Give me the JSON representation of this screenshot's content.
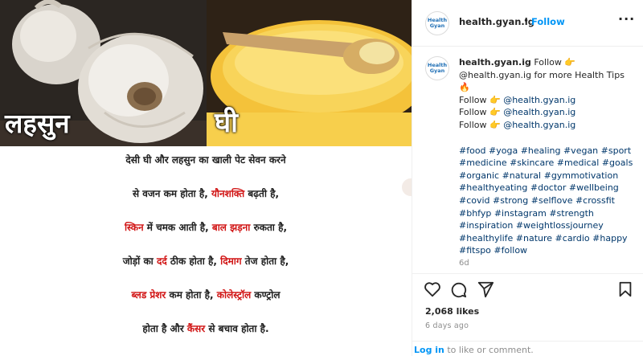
{
  "post_image": {
    "label_garlic": "लहसुन",
    "label_ghee": "घी",
    "text_lines": [
      [
        {
          "t": "देसी घी और लहसुन का खाली पेट सेवन करने",
          "red": false
        }
      ],
      [
        {
          "t": "से वजन कम होता है, ",
          "red": false
        },
        {
          "t": "यौनशक्ति",
          "red": true
        },
        {
          "t": " बढ़ती है,",
          "red": false
        }
      ],
      [
        {
          "t": "स्किन",
          "red": true
        },
        {
          "t": " में चमक आती है, ",
          "red": false
        },
        {
          "t": "बाल झड़ना",
          "red": true
        },
        {
          "t": " रुकता है,",
          "red": false
        }
      ],
      [
        {
          "t": "जोड़ों का ",
          "red": false
        },
        {
          "t": "दर्द",
          "red": true
        },
        {
          "t": " ठीक होता है, ",
          "red": false
        },
        {
          "t": "दिमाग",
          "red": true
        },
        {
          "t": " तेज होता है,",
          "red": false
        }
      ],
      [
        {
          "t": "ब्लड प्रेशर",
          "red": true
        },
        {
          "t": " कम होता है, ",
          "red": false
        },
        {
          "t": "कोलेस्ट्रॉल",
          "red": true
        },
        {
          "t": " कण्ट्रोल",
          "red": false
        }
      ],
      [
        {
          "t": "होता है और ",
          "red": false
        },
        {
          "t": "कैंसर",
          "red": true
        },
        {
          "t": " से बचाव होता है.",
          "red": false
        }
      ]
    ]
  },
  "header": {
    "avatar_text_1": "Health",
    "avatar_text_2": "Gyan",
    "username": "health.gyan.ig",
    "dot": "•",
    "follow_label": "Follow",
    "more_label": "···"
  },
  "caption": {
    "username": "health.gyan.ig",
    "line1_rest": " Follow 👉",
    "line2": "@health.gyan.ig for more Health Tips",
    "line3": "🔥",
    "follow_lines": [
      {
        "prefix": "Follow 👉 ",
        "mention": "@health.gyan.ig"
      },
      {
        "prefix": "Follow 👉 ",
        "mention": "@health.gyan.ig"
      },
      {
        "prefix": "Follow 👉 ",
        "mention": "@health.gyan.ig"
      }
    ],
    "hashtags": "#food #yoga #healing #vegan #sport #medicine #skincare #medical #goals #organic #natural #gymmotivation #healthyeating #doctor #wellbeing #covid #strong #selflove #crossfit #bhfyp #instagram #strength #inspiration #weightlossjourney #healthylife #nature #cardio #happy #fitspo #follow",
    "time": "6d"
  },
  "actions": {
    "icons": [
      "heart-icon",
      "comment-icon",
      "share-icon",
      "bookmark-icon"
    ]
  },
  "likes": "2,068 likes",
  "post_date": "6 days ago",
  "login": {
    "link_text": "Log in",
    "rest_text": " to like or comment."
  },
  "colors": {
    "accent_blue": "#0095f6",
    "mention_blue": "#00376b",
    "highlight_red": "#d11414"
  }
}
